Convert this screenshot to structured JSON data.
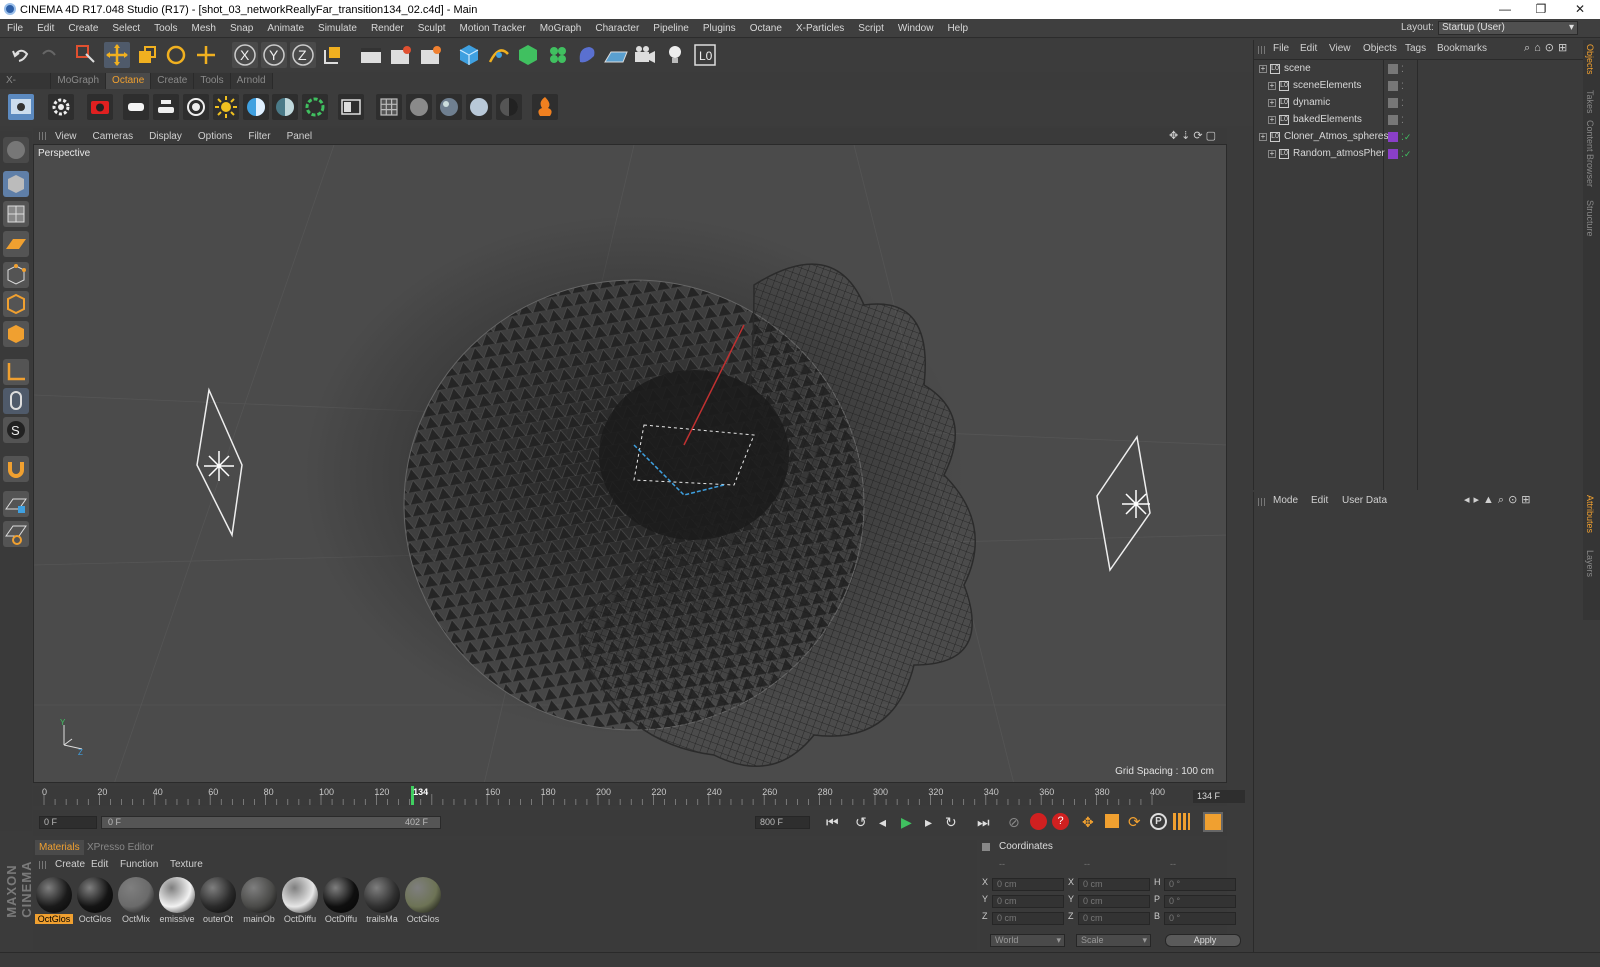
{
  "window": {
    "title": "CINEMA 4D R17.048 Studio (R17) - [shot_03_networkReallyFar_transition134_02.c4d] - Main",
    "controls": [
      "—",
      "❐",
      "✕"
    ]
  },
  "menubar": {
    "items": [
      "File",
      "Edit",
      "Create",
      "Select",
      "Tools",
      "Mesh",
      "Snap",
      "Animate",
      "Simulate",
      "Render",
      "Sculpt",
      "Motion Tracker",
      "MoGraph",
      "Character",
      "Pipeline",
      "Plugins",
      "Octane",
      "X-Particles",
      "Script",
      "Window",
      "Help"
    ],
    "layout_label": "Layout:",
    "layout_value": "Startup (User)"
  },
  "plugin_tabs": [
    "X-Particles",
    "MoGraph",
    "Octane",
    "Create",
    "Tools",
    "Arnold"
  ],
  "active_plugin_tab": "Octane",
  "viewport": {
    "menu": [
      "View",
      "Cameras",
      "Display",
      "Options",
      "Filter",
      "Panel"
    ],
    "label": "Perspective",
    "grid_spacing": "Grid Spacing : 100 cm"
  },
  "timeline": {
    "ticks": [
      "0",
      "20",
      "40",
      "60",
      "80",
      "100",
      "120",
      "134",
      "160",
      "180",
      "200",
      "220",
      "240",
      "260",
      "280",
      "300",
      "320",
      "340",
      "360",
      "380",
      "400"
    ],
    "current_frame": 134,
    "current_frame_label": "134 F",
    "range_start": "0 F",
    "range_min": "0 F",
    "range_max": "402 F",
    "range_end": "800 F",
    "playhead_marker": "134"
  },
  "materials": {
    "tabs": [
      "Materials",
      "XPresso Editor"
    ],
    "menu": [
      "Create",
      "Edit",
      "Function",
      "Texture"
    ],
    "items": [
      {
        "label": "OctGlos",
        "selected": true,
        "color": "#1a1a1a"
      },
      {
        "label": "OctGlos",
        "selected": false,
        "color": "#141414"
      },
      {
        "label": "OctMix",
        "selected": false,
        "color": "#6a6a6a"
      },
      {
        "label": "emissive",
        "selected": false,
        "color": "#f2f2f2"
      },
      {
        "label": "outerOt",
        "selected": false,
        "color": "#2a2a2a"
      },
      {
        "label": "mainOb",
        "selected": false,
        "color": "#4a4a48"
      },
      {
        "label": "OctDiffu",
        "selected": false,
        "color": "#e6e6e6"
      },
      {
        "label": "OctDiffu",
        "selected": false,
        "color": "#0f0f0f"
      },
      {
        "label": "trailsMa",
        "selected": false,
        "color": "#303030"
      },
      {
        "label": "OctGlos",
        "selected": false,
        "color": "#6d7355"
      }
    ]
  },
  "coordinates": {
    "title": "Coordinates",
    "headers": [
      "--",
      "--",
      "--"
    ],
    "rows": [
      {
        "a": "X",
        "av": "0 cm",
        "b": "X",
        "bv": "0 cm",
        "c": "H",
        "cv": "0 °"
      },
      {
        "a": "Y",
        "av": "0 cm",
        "b": "Y",
        "bv": "0 cm",
        "c": "P",
        "cv": "0 °"
      },
      {
        "a": "Z",
        "av": "0 cm",
        "b": "Z",
        "bv": "0 cm",
        "c": "B",
        "cv": "0 °"
      }
    ],
    "space": "World",
    "mode": "Scale",
    "apply": "Apply"
  },
  "object_manager": {
    "menu": [
      "File",
      "Edit",
      "View",
      "Objects",
      "Tags",
      "Bookmarks"
    ],
    "objects": [
      {
        "name": "scene",
        "indent": 0,
        "tag_color": ""
      },
      {
        "name": "sceneElements",
        "indent": 1,
        "tag_color": ""
      },
      {
        "name": "dynamic",
        "indent": 1,
        "tag_color": ""
      },
      {
        "name": "bakedElements",
        "indent": 1,
        "tag_color": ""
      },
      {
        "name": "Cloner_Atmos_spheres",
        "indent": 0,
        "tag_color": "#8a3fc8"
      },
      {
        "name": "Random_atmosPher",
        "indent": 1,
        "tag_color": "#8a3fc8"
      }
    ]
  },
  "attribute_manager": {
    "menu": [
      "Mode",
      "Edit",
      "User Data"
    ]
  },
  "side_tabs": [
    "Objects",
    "Takes",
    "Content Browser",
    "Structure",
    "Attributes",
    "Layers"
  ],
  "branding": "MAXON CINEMA 4D"
}
